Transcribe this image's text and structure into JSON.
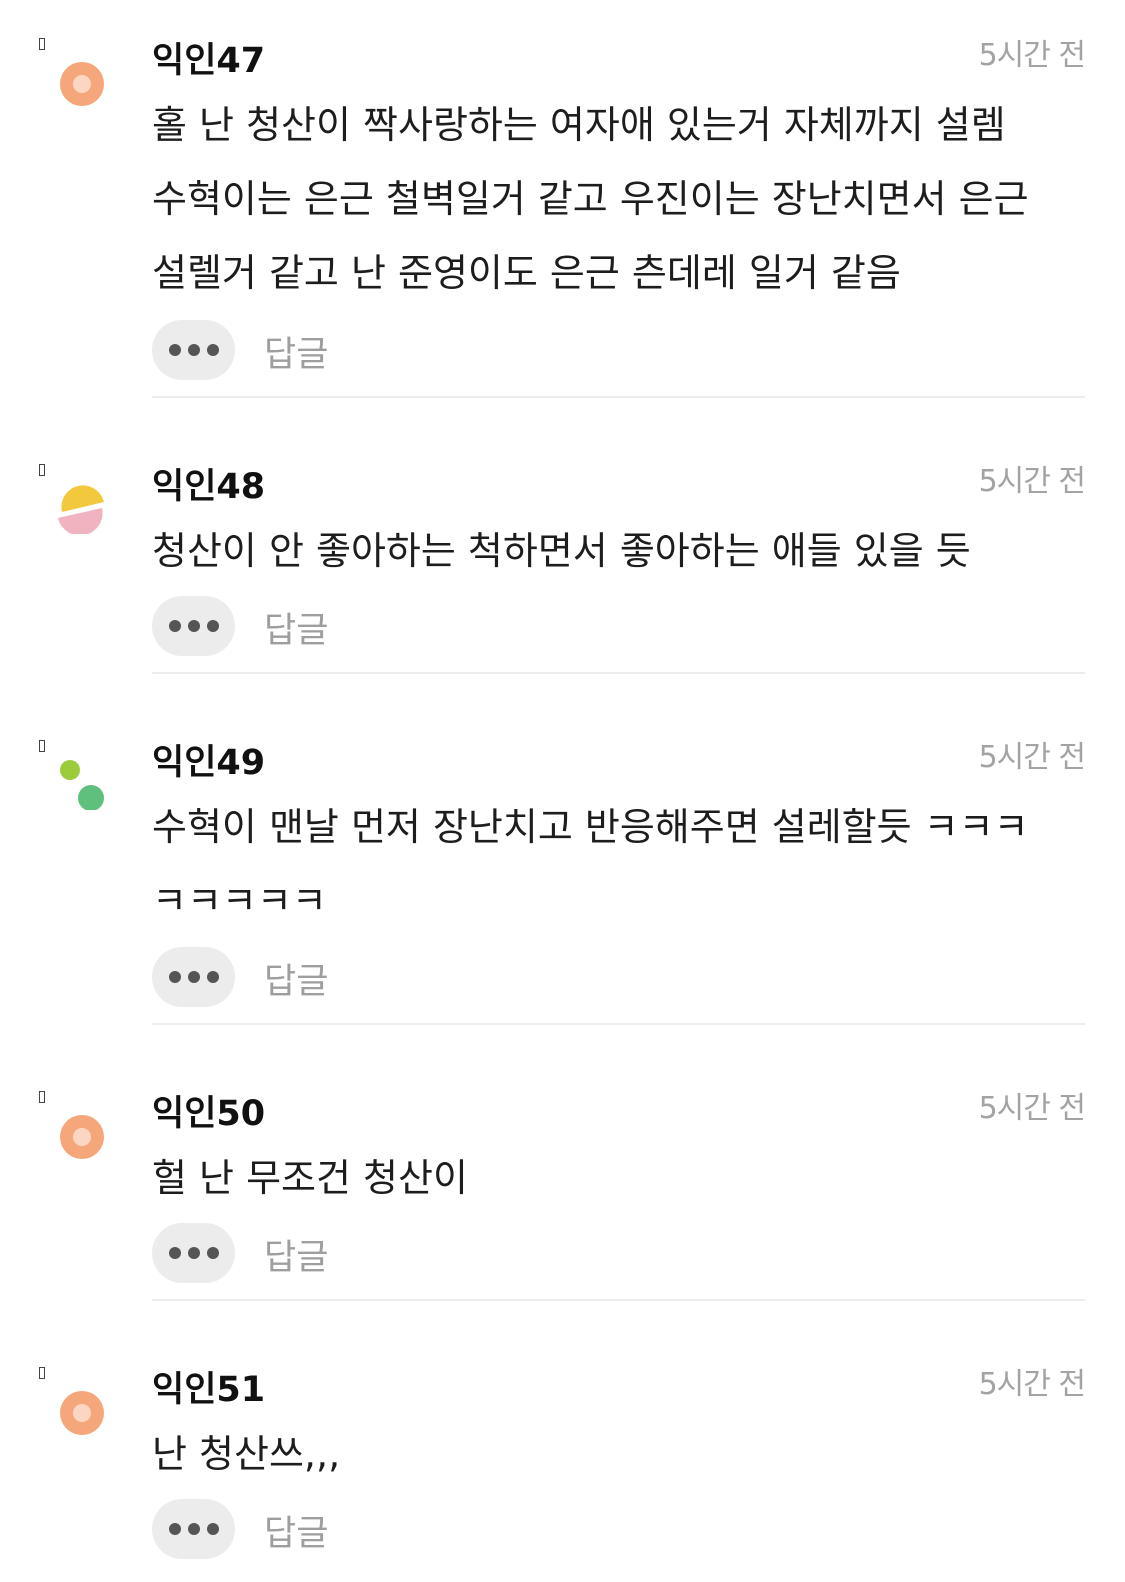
{
  "colors": {
    "avatar_orange": "#f5a77b",
    "avatar_yellow": "#f2c83c",
    "avatar_pink": "#f1b3c0",
    "avatar_lime": "#9ccc3c",
    "avatar_green": "#5fbf7d"
  },
  "comments": [
    {
      "name": "익인47",
      "time": "5시간 전",
      "text": "홀 난 청산이 짝사랑하는 여자애 있는거 자체까지 설렘 수혁이는 은근 철벽일거 같고 우진이는 장난치면서 은근 설렐거 같고 난 준영이도 은근 츤데레 일거 같음",
      "reply": "답글",
      "avatar": "orange-ring"
    },
    {
      "name": "익인48",
      "time": "5시간 전",
      "text": "청산이 안 좋아하는 척하면서 좋아하는 애들 있을 듯",
      "reply": "답글",
      "avatar": "yellow-pink-halves"
    },
    {
      "name": "익인49",
      "time": "5시간 전",
      "text": "수혁이 맨날 먼저 장난치고 반응해주면 설레할듯 ㅋㅋㅋ ㅋㅋㅋㅋㅋ",
      "reply": "답글",
      "avatar": "green-dots"
    },
    {
      "name": "익인50",
      "time": "5시간 전",
      "text": "헐 난 무조건 청산이",
      "reply": "답글",
      "avatar": "orange-ring"
    },
    {
      "name": "익인51",
      "time": "5시간 전",
      "text": "난 청산쓰,,,",
      "reply": "답글",
      "avatar": "orange-ring"
    }
  ]
}
